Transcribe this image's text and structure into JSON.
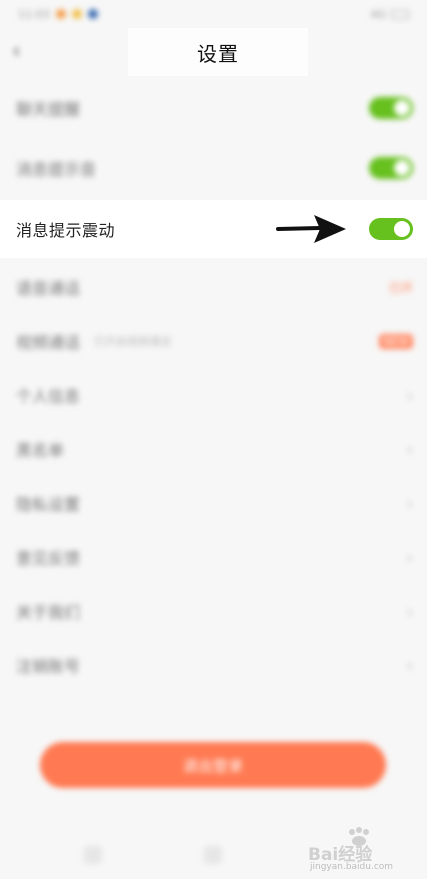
{
  "status_bar": {
    "time": "11:03",
    "signal": "4G",
    "battery": ""
  },
  "nav": {
    "title": "设置",
    "back_icon": "back-chevron-icon"
  },
  "rows": [
    {
      "label": "聊天提醒",
      "control": "toggle",
      "on": true
    },
    {
      "label": "消息提示音",
      "control": "toggle",
      "on": true
    },
    {
      "label": "消息提示震动",
      "control": "toggle",
      "on": true
    },
    {
      "label": "语音通话",
      "control": "value",
      "value": "已开"
    },
    {
      "label": "视频通话",
      "sub": "已开启视频通话",
      "control": "badge",
      "value": "NEW"
    },
    {
      "label": "个人信息",
      "control": "chevron"
    },
    {
      "label": "黑名单",
      "control": "chevron"
    },
    {
      "label": "隐私设置",
      "control": "chevron"
    },
    {
      "label": "意见反馈",
      "control": "chevron"
    },
    {
      "label": "关于我们",
      "control": "chevron"
    },
    {
      "label": "注销账号",
      "control": "chevron"
    }
  ],
  "logout": {
    "label": "退出登录"
  },
  "watermark": {
    "text": "Bai经验",
    "url": "jingyan.baidu.com"
  },
  "colors": {
    "toggle_on": "#66c01e",
    "accent": "#ff7a52"
  }
}
